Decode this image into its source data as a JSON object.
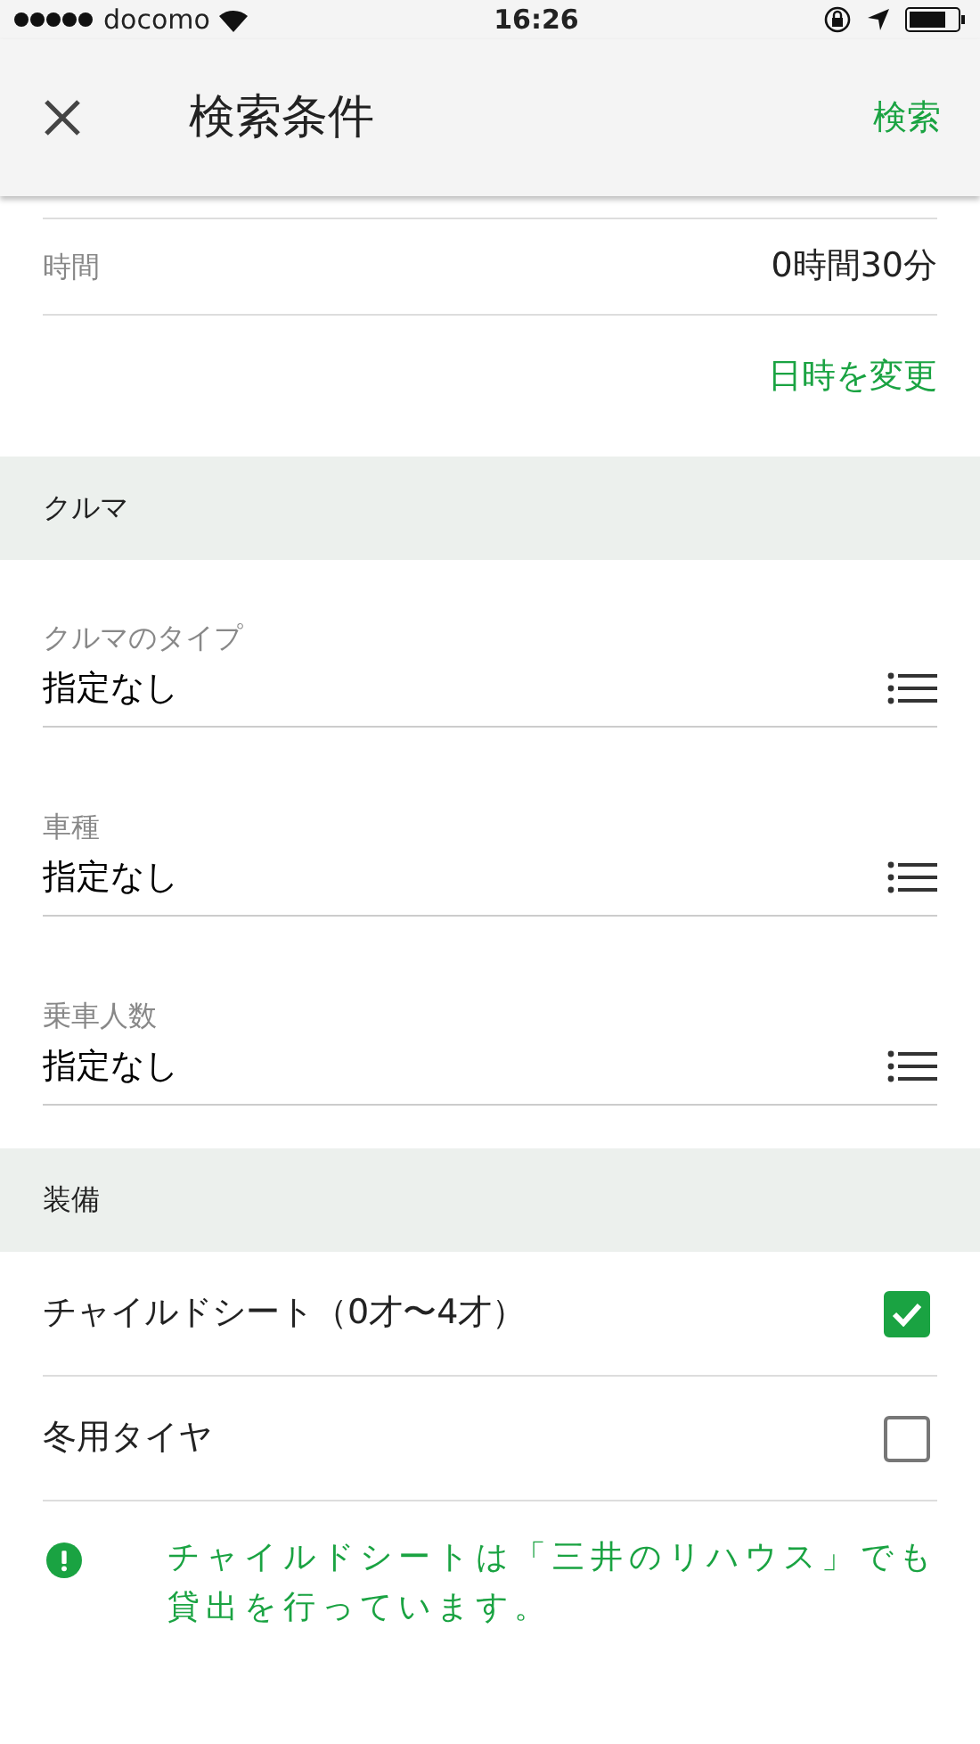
{
  "status_bar": {
    "carrier": "docomo",
    "time": "16:26"
  },
  "header": {
    "title": "検索条件",
    "action": "検索"
  },
  "time_row": {
    "label": "時間",
    "value": "0時間30分"
  },
  "change_link": "日時を変更",
  "sections": [
    {
      "title": "クルマ",
      "kind": "selects",
      "items": [
        {
          "label": "クルマのタイプ",
          "value": "指定なし"
        },
        {
          "label": "車種",
          "value": "指定なし"
        },
        {
          "label": "乗車人数",
          "value": "指定なし"
        }
      ]
    },
    {
      "title": "装備",
      "kind": "checks",
      "items": [
        {
          "label": "チャイルドシート（0才〜4才）",
          "checked": true
        },
        {
          "label": "冬用タイヤ",
          "checked": false
        }
      ]
    }
  ],
  "note": "チャイルドシートは「三井のリハウス」でも貸出を行っています。"
}
